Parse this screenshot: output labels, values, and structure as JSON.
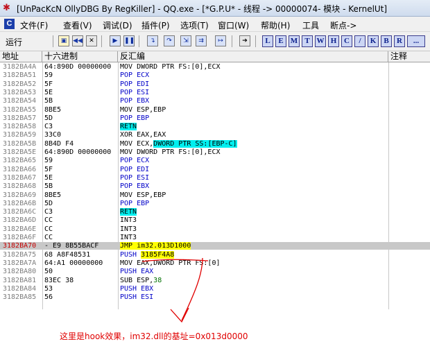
{
  "window": {
    "title": "[UnPacKcN OllyDBG By RegKiller] - QQ.exe - [*G.P.U* - 线程 -> 00000074- 模块 - KernelUt]"
  },
  "menu": {
    "logo": "C",
    "items": [
      "文件(F)",
      "查看(V)",
      "调试(D)",
      "插件(P)",
      "选项(T)",
      "窗口(W)",
      "帮助(H)",
      "工具",
      "断点->"
    ]
  },
  "toolbar": {
    "run_label": "运行",
    "letters": [
      "L",
      "E",
      "M",
      "T",
      "W",
      "H",
      "C",
      "/",
      "K",
      "B",
      "R",
      "..."
    ]
  },
  "columns": {
    "address": "地址",
    "hex": "十六进制",
    "disasm": "反汇编",
    "comment": "注释"
  },
  "rows": [
    {
      "addr": "3182BA4A",
      "hex": "64:890D 00000000",
      "dis": [
        [
          "MOV DWORD PTR FS:[0],ECX",
          ""
        ]
      ]
    },
    {
      "addr": "3182BA51",
      "hex": "59",
      "dis": [
        [
          "POP ECX",
          "blue"
        ]
      ]
    },
    {
      "addr": "3182BA52",
      "hex": "5F",
      "dis": [
        [
          "POP EDI",
          "blue"
        ]
      ]
    },
    {
      "addr": "3182BA53",
      "hex": "5E",
      "dis": [
        [
          "POP ESI",
          "blue"
        ]
      ]
    },
    {
      "addr": "3182BA54",
      "hex": "5B",
      "dis": [
        [
          "POP EBX",
          "blue"
        ]
      ]
    },
    {
      "addr": "3182BA55",
      "hex": "8BE5",
      "dis": [
        [
          "MOV ESP,EBP",
          ""
        ]
      ]
    },
    {
      "addr": "3182BA57",
      "hex": "5D",
      "dis": [
        [
          "POP EBP",
          "blue"
        ]
      ]
    },
    {
      "addr": "3182BA58",
      "hex": "C3",
      "dis": [
        [
          "RETN",
          "cyan"
        ]
      ]
    },
    {
      "addr": "3182BA59",
      "hex": "33C0",
      "dis": [
        [
          "XOR EAX,EAX",
          ""
        ]
      ]
    },
    {
      "addr": "3182BA5B",
      "hex": "8B4D F4",
      "dis": [
        [
          "MOV ECX,",
          ""
        ],
        [
          "DWORD PTR SS:[EBP-C]",
          "cyan"
        ]
      ]
    },
    {
      "addr": "3182BA5E",
      "hex": "64:890D 00000000",
      "dis": [
        [
          "MOV DWORD PTR FS:[0],ECX",
          ""
        ]
      ]
    },
    {
      "addr": "3182BA65",
      "hex": "59",
      "dis": [
        [
          "POP ECX",
          "blue"
        ]
      ]
    },
    {
      "addr": "3182BA66",
      "hex": "5F",
      "dis": [
        [
          "POP EDI",
          "blue"
        ]
      ]
    },
    {
      "addr": "3182BA67",
      "hex": "5E",
      "dis": [
        [
          "POP ESI",
          "blue"
        ]
      ]
    },
    {
      "addr": "3182BA68",
      "hex": "5B",
      "dis": [
        [
          "POP EBX",
          "blue"
        ]
      ]
    },
    {
      "addr": "3182BA69",
      "hex": "8BE5",
      "dis": [
        [
          "MOV ESP,EBP",
          ""
        ]
      ]
    },
    {
      "addr": "3182BA6B",
      "hex": "5D",
      "dis": [
        [
          "POP EBP",
          "blue"
        ]
      ]
    },
    {
      "addr": "3182BA6C",
      "hex": "C3",
      "dis": [
        [
          "RETN",
          "cyan"
        ]
      ]
    },
    {
      "addr": "3182BA6D",
      "hex": "CC",
      "dis": [
        [
          "INT3",
          ""
        ]
      ]
    },
    {
      "addr": "3182BA6E",
      "hex": "CC",
      "dis": [
        [
          "INT3",
          ""
        ]
      ]
    },
    {
      "addr": "3182BA6F",
      "hex": "CC",
      "dis": [
        [
          "INT3",
          ""
        ]
      ]
    },
    {
      "addr": "3182BA70",
      "hex": "- E9 8B55BACF",
      "dis": [
        [
          "JMP im32.013D1000",
          "yellow"
        ]
      ],
      "selected": true
    },
    {
      "addr": "3182BA75",
      "hex": "68 A8F48531",
      "dis": [
        [
          "PUSH ",
          "blue"
        ],
        [
          "3185F4A8",
          "yellow"
        ]
      ]
    },
    {
      "addr": "3182BA7A",
      "hex": "64:A1 00000000",
      "dis": [
        [
          "MOV EAX,DWORD PTR FS:[0]",
          ""
        ]
      ]
    },
    {
      "addr": "3182BA80",
      "hex": "50",
      "dis": [
        [
          "PUSH EAX",
          "blue"
        ]
      ]
    },
    {
      "addr": "3182BA81",
      "hex": "83EC 38",
      "dis": [
        [
          "SUB ESP,",
          ""
        ],
        [
          "38",
          "num"
        ]
      ]
    },
    {
      "addr": "3182BA84",
      "hex": "53",
      "dis": [
        [
          "PUSH EBX",
          "blue"
        ]
      ]
    },
    {
      "addr": "3182BA85",
      "hex": "56",
      "dis": [
        [
          "PUSH ESI",
          "blue"
        ]
      ]
    }
  ],
  "annotation": "这里是hook效果，im32.dll的基址=0x013d0000",
  "colors": {
    "annotation": "#e00000",
    "selected_row": "#c8c8c8",
    "highlight_cyan": "#00f0f0",
    "highlight_yellow": "#ffff00",
    "mnemonic_blue": "#0000c8"
  }
}
